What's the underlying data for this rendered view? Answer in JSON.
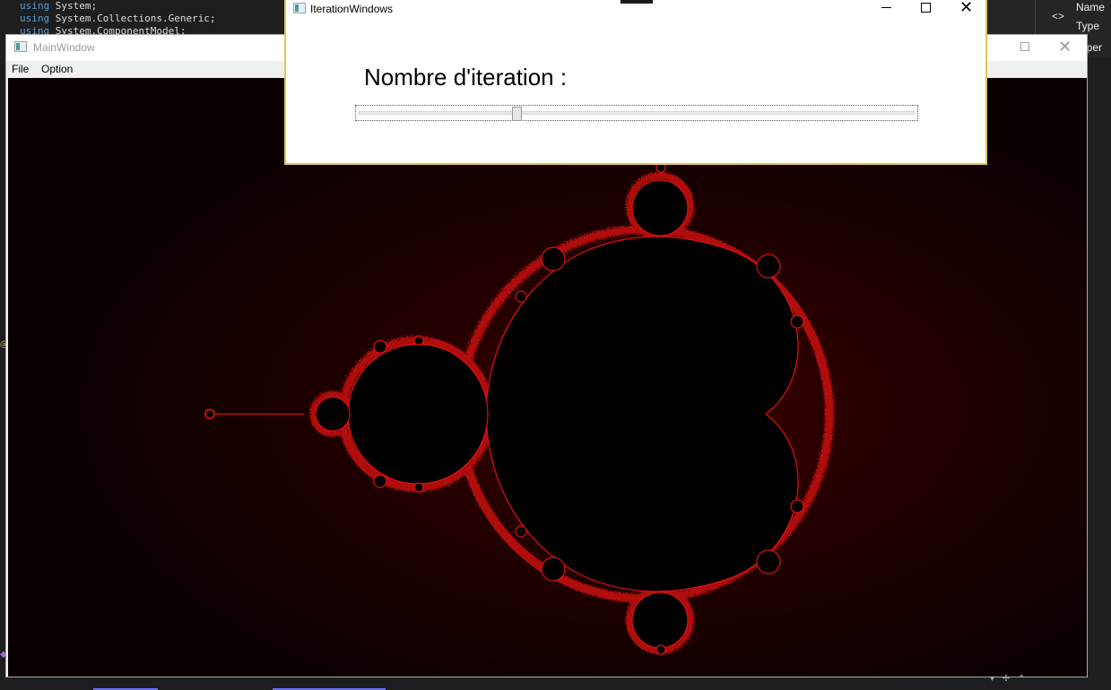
{
  "ide": {
    "code_lines": [
      {
        "kw": "using",
        "rest": " System;"
      },
      {
        "kw": "using",
        "rest": " System.Collections.Generic;"
      },
      {
        "kw": "using",
        "rest": " System.ComponentModel;"
      }
    ],
    "properties": {
      "name_label": "Name",
      "type_label": "Type",
      "strip_text": "roper",
      "brackets_icon": "<>"
    }
  },
  "main_window": {
    "title": "MainWindow",
    "menu": {
      "file_label": "File",
      "option_label": "Option"
    },
    "close_glyph": "✕"
  },
  "iteration_window": {
    "title": "IterationWindows",
    "label": "Nombre d'iteration :",
    "close_glyph": "✕",
    "slider": {
      "value_fraction": 0.28
    }
  },
  "colors": {
    "fractal_edge": "#e01010",
    "fractal_glow": "#3a0000",
    "background": "#0a0000",
    "accent_border": "#e6c44f"
  }
}
